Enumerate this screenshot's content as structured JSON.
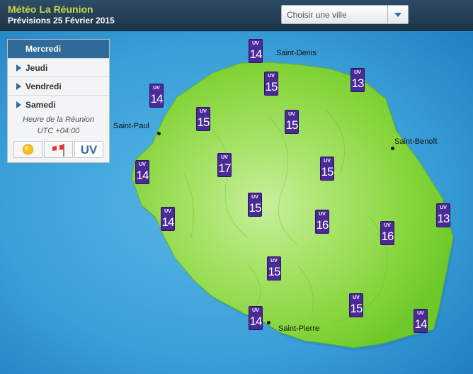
{
  "header": {
    "title": "Météo La Réunion",
    "subtitle": "Prévisions 25 Février 2015"
  },
  "city_select": {
    "value": "Choisir une ville"
  },
  "days": [
    {
      "label": "Mercredi",
      "active": true
    },
    {
      "label": "Jeudi",
      "active": false
    },
    {
      "label": "Vendredi",
      "active": false
    },
    {
      "label": "Samedi",
      "active": false
    }
  ],
  "timezone": {
    "line1": "Heure de la Réunion",
    "line2": "UTC +04:00"
  },
  "modes": [
    {
      "icon": "sun-icon"
    },
    {
      "icon": "windsock-icon"
    },
    {
      "icon": "uv-icon",
      "label": "UV"
    }
  ],
  "cities": [
    {
      "name": "Saint-Denis"
    },
    {
      "name": "Saint-Paul"
    },
    {
      "name": "Saint-Benoît"
    },
    {
      "name": "Saint-Pierre"
    }
  ],
  "uv_label": "UV",
  "uv_values": [
    "14",
    "15",
    "13",
    "14",
    "15",
    "15",
    "17",
    "15",
    "14",
    "15",
    "14",
    "16",
    "16",
    "13",
    "15",
    "15",
    "14",
    "14"
  ],
  "colors": {
    "sea": "#2a8fcf",
    "land": "#7fd43a",
    "uv_badge": "#4a2a96",
    "header": "#2e4c66",
    "title": "#c6d94a"
  }
}
